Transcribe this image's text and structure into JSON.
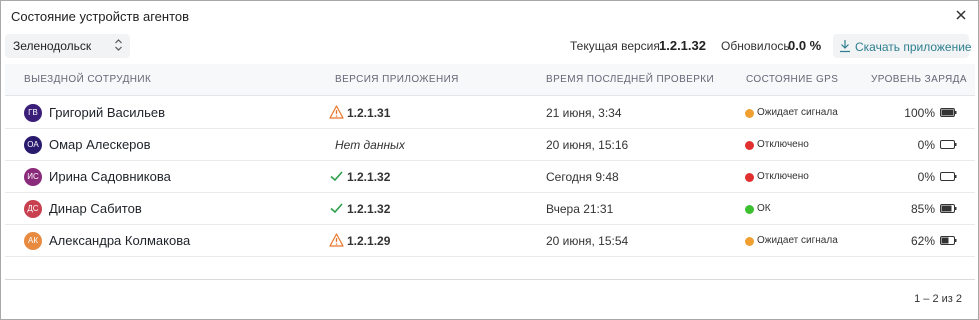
{
  "dialog": {
    "title": "Состояние устройств агентов",
    "close_icon": "close-icon"
  },
  "toolbar": {
    "city": "Зеленодольск",
    "version_label": "Текущая версия",
    "version_value": "1.2.1.32",
    "updated_label": "Обновилось",
    "updated_value": "0.0 %",
    "download_label": "Скачать приложение"
  },
  "table": {
    "headers": {
      "employee": "ВЫЕЗДНОЙ СОТРУДНИК",
      "version": "ВЕРСИЯ ПРИЛОЖЕНИЯ",
      "last_check": "ВРЕМЯ ПОСЛЕДНЕЙ ПРОВЕРКИ",
      "gps": "СОСТОЯНИЕ GPS",
      "charge": "УРОВЕНЬ ЗАРЯДА"
    },
    "rows": [
      {
        "initials": "ГВ",
        "avatar_color": "#3b1e7a",
        "name": "Григорий Васильев",
        "version_status": "warning",
        "version": "1.2.1.31",
        "last_check": "21 июня, 3:34",
        "gps_color": "#f0a030",
        "gps": "Ожидает сигнала",
        "charge": "100%",
        "charge_level": 1.0
      },
      {
        "initials": "ОА",
        "avatar_color": "#2a1a6e",
        "name": "Омар Алескеров",
        "version_status": "none",
        "version": "Нет данных",
        "last_check": "20 июня, 15:16",
        "gps_color": "#e03030",
        "gps": "Отключено",
        "charge": "0%",
        "charge_level": 0.0
      },
      {
        "initials": "ИС",
        "avatar_color": "#8a2a7a",
        "name": "Ирина Садовникова",
        "version_status": "ok",
        "version": "1.2.1.32",
        "last_check": "Сегодня 9:48",
        "gps_color": "#e03030",
        "gps": "Отключено",
        "charge": "0%",
        "charge_level": 0.0
      },
      {
        "initials": "ДС",
        "avatar_color": "#c84050",
        "name": "Динар Сабитов",
        "version_status": "ok",
        "version": "1.2.1.32",
        "last_check": "Вчера 21:31",
        "gps_color": "#3cc030",
        "gps": "ОК",
        "charge": "85%",
        "charge_level": 0.85
      },
      {
        "initials": "АК",
        "avatar_color": "#e88a40",
        "name": "Александра Колмакова",
        "version_status": "warning",
        "version": "1.2.1.29",
        "last_check": "20 июня, 15:54",
        "gps_color": "#f0a030",
        "gps": "Ожидает сигнала",
        "charge": "62%",
        "charge_level": 0.62
      }
    ]
  },
  "pagination": {
    "text": "1 – 2 из 2"
  },
  "colors": {
    "accent": "#2f7f8f",
    "warning": "#e8762a",
    "ok": "#2e9e4a"
  }
}
